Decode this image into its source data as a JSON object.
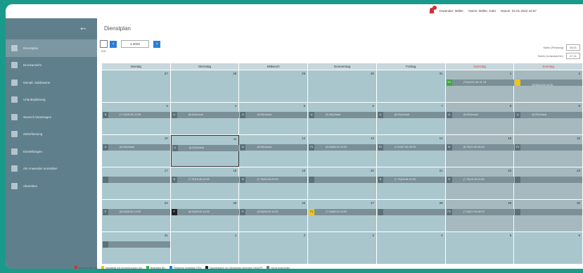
{
  "topbar": {
    "user_label": "Anwender: Müller",
    "name_label": "Name: Müller, Gabi",
    "date_label": "Datum: 04.01.2022 15:57"
  },
  "sidebar": {
    "items": [
      {
        "label": "Dienstplan",
        "icon": "calendar-icon",
        "active": true
      },
      {
        "label": "Druckansicht",
        "icon": "print-icon"
      },
      {
        "label": "Monatl. Saldowerte",
        "icon": "sum-icon"
      },
      {
        "label": "Urlaubsplanung",
        "icon": "vacation-icon"
      },
      {
        "label": "Wunsch beantragen",
        "icon": "request-icon"
      },
      {
        "label": "Zeiterfassung",
        "icon": "clock-icon"
      },
      {
        "label": "Einstellungen",
        "icon": "gear-icon"
      },
      {
        "label": "Als Anwender anmelden",
        "icon": "login-icon"
      },
      {
        "label": "Abmelden",
        "icon": "logout-icon"
      }
    ]
  },
  "main": {
    "title": "Dienstplan",
    "period": "1.2022",
    "kw": "KW",
    "saldo_plan_label": "Saldo (Planung)",
    "saldo_plan_value": "48,61",
    "saldo_ist_label": "Saldo (voraussichtl.)",
    "saldo_ist_value": "47,11"
  },
  "calendar": {
    "weekdays": [
      "Montag",
      "Dienstag",
      "Mittwoch",
      "Donnerstag",
      "Freitag",
      "Samstag",
      "Sonntag"
    ],
    "weekend_color": "#e2473b",
    "weeks": [
      {
        "days": [
          {
            "n": "27",
            "out": true
          },
          {
            "n": "28",
            "out": true
          },
          {
            "n": "29",
            "out": true
          },
          {
            "n": "30",
            "out": true
          },
          {
            "n": "31",
            "out": true
          },
          {
            "n": "1",
            "ev": {
              "type": "TG",
              "color": "g",
              "text": "(TG)2021-06-31 15"
            }
          },
          {
            "n": "2",
            "ev": {
              "type": "",
              "color": "y",
              "text": "(8:00)10:00-12:00"
            }
          }
        ]
      },
      {
        "days": [
          {
            "n": "3",
            "ev": {
              "type": "K",
              "text": "(7:15)15:45-22:00"
            }
          },
          {
            "n": "4",
            "ev": {
              "type": "U",
              "text": "(8,00)Urlaub"
            }
          },
          {
            "n": "5",
            "ev": {
              "type": "U",
              "text": "(8,00)Urlaub"
            }
          },
          {
            "n": "6",
            "ev": {
              "type": "U",
              "text": "(8,00)Urlaub"
            }
          },
          {
            "n": "7",
            "ev": {
              "type": "U",
              "text": "(8,00)Urlaub"
            }
          },
          {
            "n": "8",
            "ev": {
              "type": "U",
              "text": "(8,00)Urlaub"
            }
          },
          {
            "n": "9",
            "ev": {
              "type": "U",
              "text": "(8,00)Urlaub"
            }
          }
        ]
      },
      {
        "days": [
          {
            "n": "10",
            "ev": {
              "type": "U",
              "text": "(8,00)Urlaub"
            }
          },
          {
            "n": "11",
            "sel": true,
            "ev": {
              "type": "U",
              "text": "(8,00)Urlaub"
            }
          },
          {
            "n": "12",
            "ev": {
              "type": "U",
              "text": "(8,00)Urlaub"
            }
          },
          {
            "n": "13",
            "ev": {
              "type": "F1",
              "text": "(8,00)06:00-12:00"
            }
          },
          {
            "n": "14",
            "ev": {
              "type": "F2",
              "text": "(7,00)07:00-08:15"
            }
          },
          {
            "n": "15",
            "ev": {
              "type": "N",
              "text": "(8,75)21:00-06:00"
            }
          },
          {
            "n": "16",
            "ev": {
              "type": "F1",
              "text": ""
            }
          }
        ]
      },
      {
        "days": [
          {
            "n": "17",
            "ev": {
              "type": "",
              "text": ""
            }
          },
          {
            "n": "18",
            "ev": {
              "type": "S",
              "text": "(7,75)15:45-22:00"
            }
          },
          {
            "n": "19",
            "ev": {
              "type": "S",
              "text": "(7,75)15:45-22:00"
            }
          },
          {
            "n": "20",
            "ev": {
              "type": "",
              "text": ""
            }
          },
          {
            "n": "21",
            "ev": {
              "type": "S",
              "text": "(7,75)15:45-22:00"
            }
          },
          {
            "n": "22",
            "ev": {
              "type": "S",
              "text": "(7,75)15:45-22:00"
            }
          },
          {
            "n": "23",
            "ev": {
              "type": "",
              "text": ""
            }
          }
        ]
      },
      {
        "days": [
          {
            "n": "24",
            "ev": {
              "type": "F",
              "text": "(8,00)06:00-14:30"
            }
          },
          {
            "n": "25",
            "ev": {
              "type": "F",
              "color": "k",
              "text": "(8,00)06:00-14:30"
            }
          },
          {
            "n": "26",
            "ev": {
              "type": "F",
              "text": "(8,00)06:00-14:30"
            }
          },
          {
            "n": "27",
            "ev": {
              "type": "F1",
              "color": "y",
              "text": "(7,00)06:00-13:00"
            }
          },
          {
            "n": "28",
            "ev": {
              "type": "",
              "text": ""
            }
          },
          {
            "n": "29",
            "ev": {
              "type": "F2",
              "text": "(7,00)07:00-08:15"
            }
          },
          {
            "n": "30",
            "ev": {
              "type": "",
              "text": ""
            }
          }
        ]
      },
      {
        "days": [
          {
            "n": "31",
            "ev": {
              "type": "",
              "text": ""
            }
          },
          {
            "n": "1",
            "out": true
          },
          {
            "n": "2",
            "out": true
          },
          {
            "n": "3",
            "out": true
          },
          {
            "n": "4",
            "out": true
          },
          {
            "n": "5",
            "out": true
          },
          {
            "n": "6",
            "out": true
          }
        ]
      }
    ]
  },
  "legend": [
    {
      "color": "#d32f2f",
      "label": "Abgemeldet (A)"
    },
    {
      "color": "#f1c40f",
      "label": "Bestätigt mit Anmerkungen (A)"
    },
    {
      "color": "#3cab3c",
      "label": "Bestätigt (B)"
    },
    {
      "color": "#2a7fd4",
      "label": "Teilweise bestätigt (TB)"
    },
    {
      "color": "#222222",
      "label": "Nachträglich im Dienstplan geändert (NÄDP)"
    },
    {
      "color": "#777777",
      "label": "Nicht bearbeitet"
    }
  ]
}
